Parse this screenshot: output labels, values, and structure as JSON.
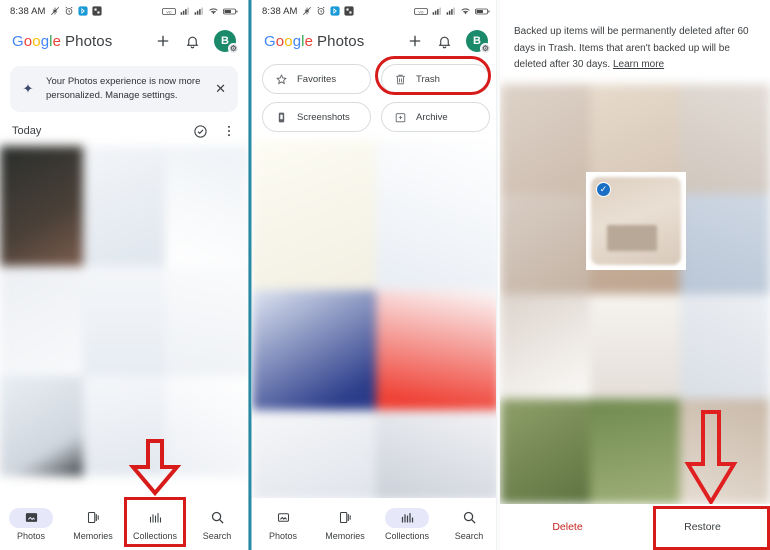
{
  "status_bar": {
    "time": "8:38 AM",
    "left_icons": [
      "mute-icon",
      "alarm-icon",
      "bluetooth-icon",
      "app-icon"
    ],
    "right_icons": [
      "vowifi-icon",
      "signal-sim1-icon",
      "signal-sim2-icon",
      "wifi-icon",
      "battery-icon"
    ]
  },
  "app": {
    "brand_letters": [
      "G",
      "o",
      "o",
      "g",
      "l",
      "e"
    ],
    "brand_word": "Photos",
    "actions": {
      "add_label": "+",
      "notifications_icon": "bell-icon",
      "avatar_initial": "B",
      "avatar_badge_icon": "gear-icon"
    }
  },
  "panel1": {
    "promo": {
      "icon": "sparkle-icon",
      "text": "Your Photos experience is now more personalized. Manage settings.",
      "close_icon": "close-icon"
    },
    "section": {
      "title": "Today",
      "select_icon": "check-circle-icon",
      "more_icon": "more-vertical-icon"
    },
    "bottom_nav": [
      {
        "label": "Photos",
        "icon": "photo-icon",
        "active": true
      },
      {
        "label": "Memories",
        "icon": "memories-icon",
        "active": false
      },
      {
        "label": "Collections",
        "icon": "collections-icon",
        "active": false
      },
      {
        "label": "Search",
        "icon": "search-icon",
        "active": false
      }
    ],
    "annotation": {
      "arrow_icon": "red-arrow-down",
      "highlight_target": "Collections"
    }
  },
  "panel2": {
    "chips": [
      {
        "label": "Favorites",
        "icon": "star-icon"
      },
      {
        "label": "Trash",
        "icon": "trash-icon",
        "highlighted": true
      },
      {
        "label": "Screenshots",
        "icon": "screenshot-icon"
      },
      {
        "label": "Archive",
        "icon": "archive-icon"
      }
    ],
    "bottom_nav": [
      {
        "label": "Photos",
        "icon": "photo-icon",
        "active": false
      },
      {
        "label": "Memories",
        "icon": "memories-icon",
        "active": false
      },
      {
        "label": "Collections",
        "icon": "collections-icon",
        "active": true
      },
      {
        "label": "Search",
        "icon": "search-icon",
        "active": false
      }
    ]
  },
  "panel3": {
    "notice": {
      "line1": "Backed up items will be permanently deleted after",
      "line2": "60 days in Trash. Items that aren't backed up will be",
      "line3": "deleted after 30 days.",
      "link": "Learn more"
    },
    "selected_item": {
      "check_icon": "check-icon",
      "selected": true
    },
    "actions": [
      {
        "label": "Delete",
        "style": "destructive"
      },
      {
        "label": "Restore",
        "style": "neutral",
        "highlighted": true
      }
    ],
    "annotation": {
      "arrow_icon": "red-arrow-down",
      "highlight_target": "Restore"
    }
  },
  "colors": {
    "annotation_red": "#d71a1a",
    "delete_red": "#c5221f",
    "accent_blue": "#1a6fc4",
    "nav_active_pill": "#e6e8fa",
    "avatar_green": "#1a8a6b",
    "divider_teal": "#1b85a0"
  }
}
